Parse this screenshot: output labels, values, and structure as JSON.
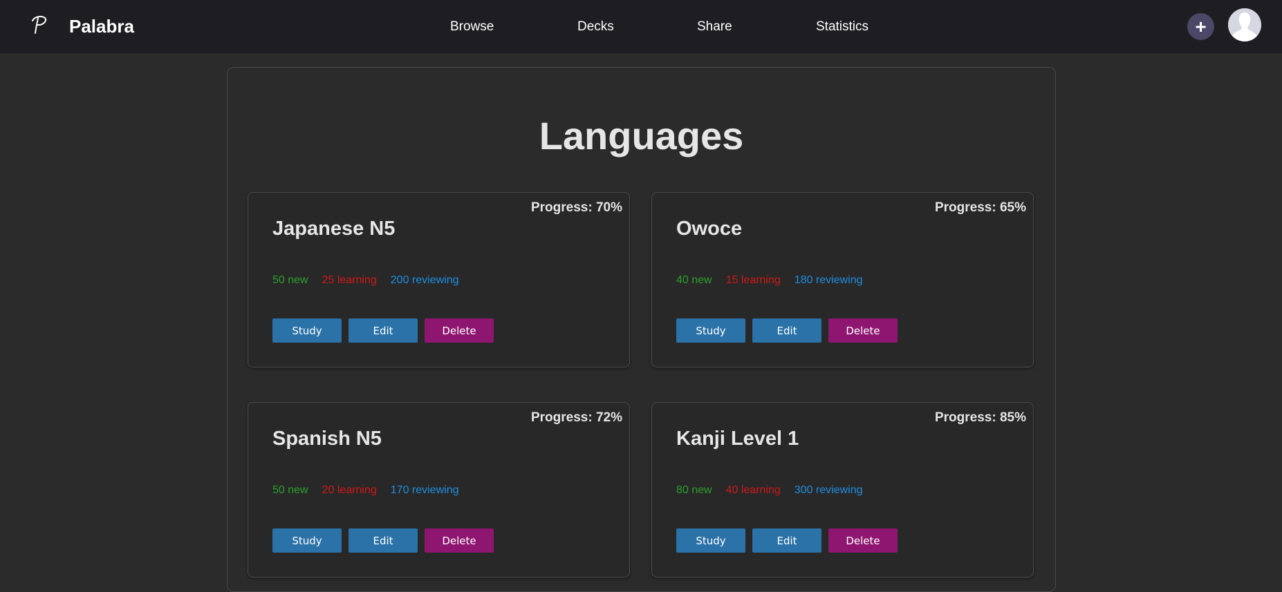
{
  "navbar": {
    "brand": "Palabra",
    "links": [
      "Browse",
      "Decks",
      "Share",
      "Statistics"
    ],
    "add_label": "+"
  },
  "main": {
    "title": "Languages"
  },
  "decks": [
    {
      "name": "Japanese N5",
      "progress": "Progress: 70%",
      "new": "50 new",
      "learning": "25 learning",
      "reviewing": "200 reviewing",
      "study": "Study",
      "edit": "Edit",
      "delete": "Delete"
    },
    {
      "name": "Owoce",
      "progress": "Progress: 65%",
      "new": "40 new",
      "learning": "15 learning",
      "reviewing": "180 reviewing",
      "study": "Study",
      "edit": "Edit",
      "delete": "Delete"
    },
    {
      "name": "Spanish N5",
      "progress": "Progress: 72%",
      "new": "50 new",
      "learning": "20 learning",
      "reviewing": "170 reviewing",
      "study": "Study",
      "edit": "Edit",
      "delete": "Delete"
    },
    {
      "name": "Kanji Level 1",
      "progress": "Progress: 85%",
      "new": "80 new",
      "learning": "40 learning",
      "reviewing": "300 reviewing",
      "study": "Study",
      "edit": "Edit",
      "delete": "Delete"
    }
  ],
  "colors": {
    "background": "#2b2b2b",
    "navbar": "#1e1e22",
    "primary_button": "#2a72a8",
    "danger_button": "#8e1670",
    "new": "#2ca02c",
    "learning": "#d01818",
    "reviewing": "#1e8fe0"
  },
  "icons": {
    "logo": "palabra-logo-icon",
    "add": "plus-icon",
    "avatar": "user-avatar-icon"
  }
}
